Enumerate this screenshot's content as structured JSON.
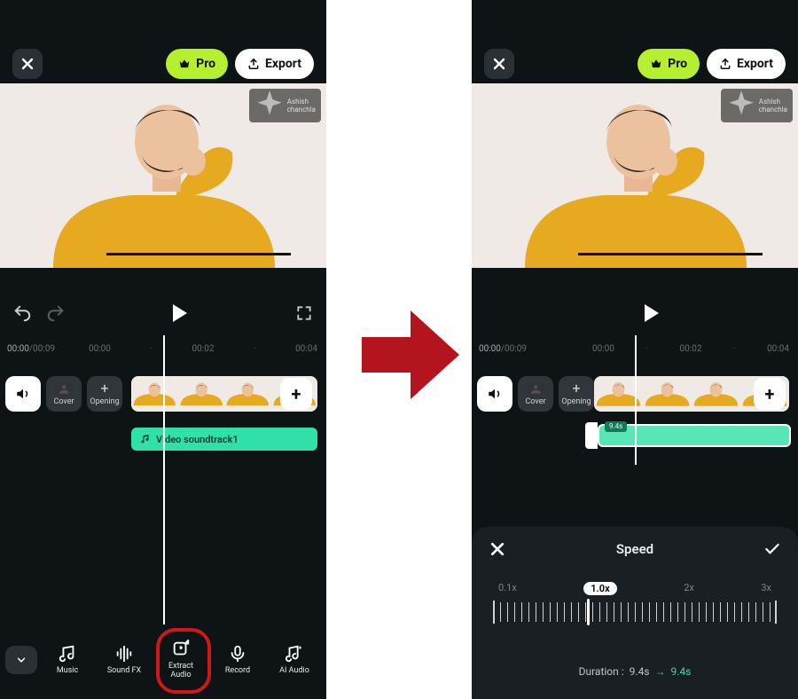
{
  "topbar": {
    "pro_label": "Pro",
    "export_label": "Export",
    "watermark": "Ashish chanchla"
  },
  "time": {
    "current": "00:00",
    "total": "/00:09",
    "ticks": [
      "00:00",
      "00:02",
      "00:04"
    ]
  },
  "tracks": {
    "mute_label": "",
    "cover_label": "Cover",
    "opening_label": "Opening",
    "add_label": "+"
  },
  "audio": {
    "clip_label": "Video soundtrack1",
    "tag": "9.4s"
  },
  "bottom": {
    "items": [
      {
        "label": "Music"
      },
      {
        "label": "Sound FX"
      },
      {
        "label": "Extract\nAudio"
      },
      {
        "label": "Record"
      },
      {
        "label": "AI Audio"
      }
    ]
  },
  "speed": {
    "title": "Speed",
    "labels": [
      "0.1x",
      "1.0x",
      "2x",
      "3x"
    ],
    "duration_label": "Duration :",
    "duration_from": "9.4s",
    "duration_to": "9.4s"
  }
}
